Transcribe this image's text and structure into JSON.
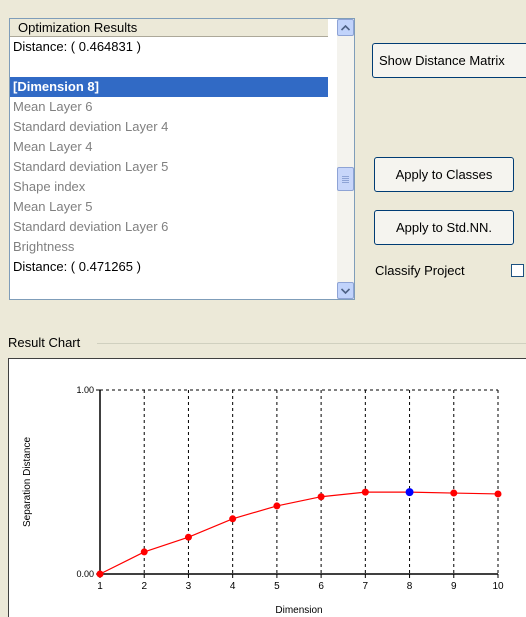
{
  "list": {
    "header": "Optimization Results",
    "items": [
      {
        "text": "Distance: ( 0.464831 )",
        "style": "normal"
      },
      {
        "text": "",
        "style": "normal"
      },
      {
        "text": "[Dimension 8]",
        "style": "selected"
      },
      {
        "text": "Mean Layer 6",
        "style": "dim"
      },
      {
        "text": "Standard deviation Layer 4",
        "style": "dim"
      },
      {
        "text": "Mean Layer 4",
        "style": "dim"
      },
      {
        "text": "Standard deviation Layer 5",
        "style": "dim"
      },
      {
        "text": "Shape index",
        "style": "dim"
      },
      {
        "text": "Mean Layer 5",
        "style": "dim"
      },
      {
        "text": "Standard deviation Layer 6",
        "style": "dim"
      },
      {
        "text": "Brightness",
        "style": "dim"
      },
      {
        "text": "Distance: ( 0.471265 )",
        "style": "normal"
      }
    ]
  },
  "buttons": {
    "show_matrix": "Show Distance Matrix",
    "apply_classes": "Apply to Classes",
    "apply_stdnn": "Apply to Std.NN."
  },
  "classify_label": "Classify Project",
  "group_title": "Result Chart",
  "chart_data": {
    "type": "line",
    "xlabel": "Dimension",
    "ylabel": "Separation Distance",
    "x": [
      1,
      2,
      3,
      4,
      5,
      6,
      7,
      8,
      9,
      10
    ],
    "y_tick_labels": [
      "0.00",
      "1.00"
    ],
    "ylim": [
      0,
      1
    ],
    "xlim": [
      1,
      10
    ],
    "grid": "vertical dashed",
    "series": [
      {
        "values": [
          0.0,
          0.12,
          0.2,
          0.3,
          0.37,
          0.42,
          0.445,
          0.445,
          0.44,
          0.435
        ],
        "color": "#ff0000"
      }
    ],
    "highlight": {
      "x": 8,
      "y": 0.445,
      "color": "#0000ff"
    }
  }
}
